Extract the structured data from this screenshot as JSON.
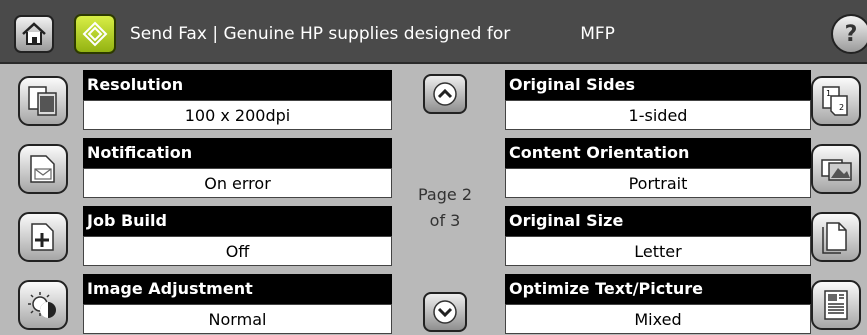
{
  "header": {
    "title": "Send Fax | Genuine HP supplies designed for",
    "title_suffix": "MFP",
    "help_label": "?"
  },
  "left_settings": [
    {
      "label": "Resolution",
      "value": "100 x 200dpi",
      "icon": "resolution-icon"
    },
    {
      "label": "Notification",
      "value": "On error",
      "icon": "notification-icon"
    },
    {
      "label": "Job Build",
      "value": "Off",
      "icon": "job-build-icon"
    },
    {
      "label": "Image Adjustment",
      "value": "Normal",
      "icon": "image-adjustment-icon"
    }
  ],
  "right_settings": [
    {
      "label": "Original Sides",
      "value": "1-sided",
      "icon": "original-sides-icon"
    },
    {
      "label": "Content Orientation",
      "value": "Portrait",
      "icon": "content-orientation-icon"
    },
    {
      "label": "Original Size",
      "value": "Letter",
      "icon": "original-size-icon"
    },
    {
      "label": "Optimize Text/Picture",
      "value": "Mixed",
      "icon": "optimize-text-picture-icon"
    }
  ],
  "pagination": {
    "line1": "Page 2",
    "line2": "of 3"
  },
  "colors": {
    "background": "#b9b9b9",
    "header": "#4a4a4a",
    "app_icon": "#b4d42a"
  }
}
